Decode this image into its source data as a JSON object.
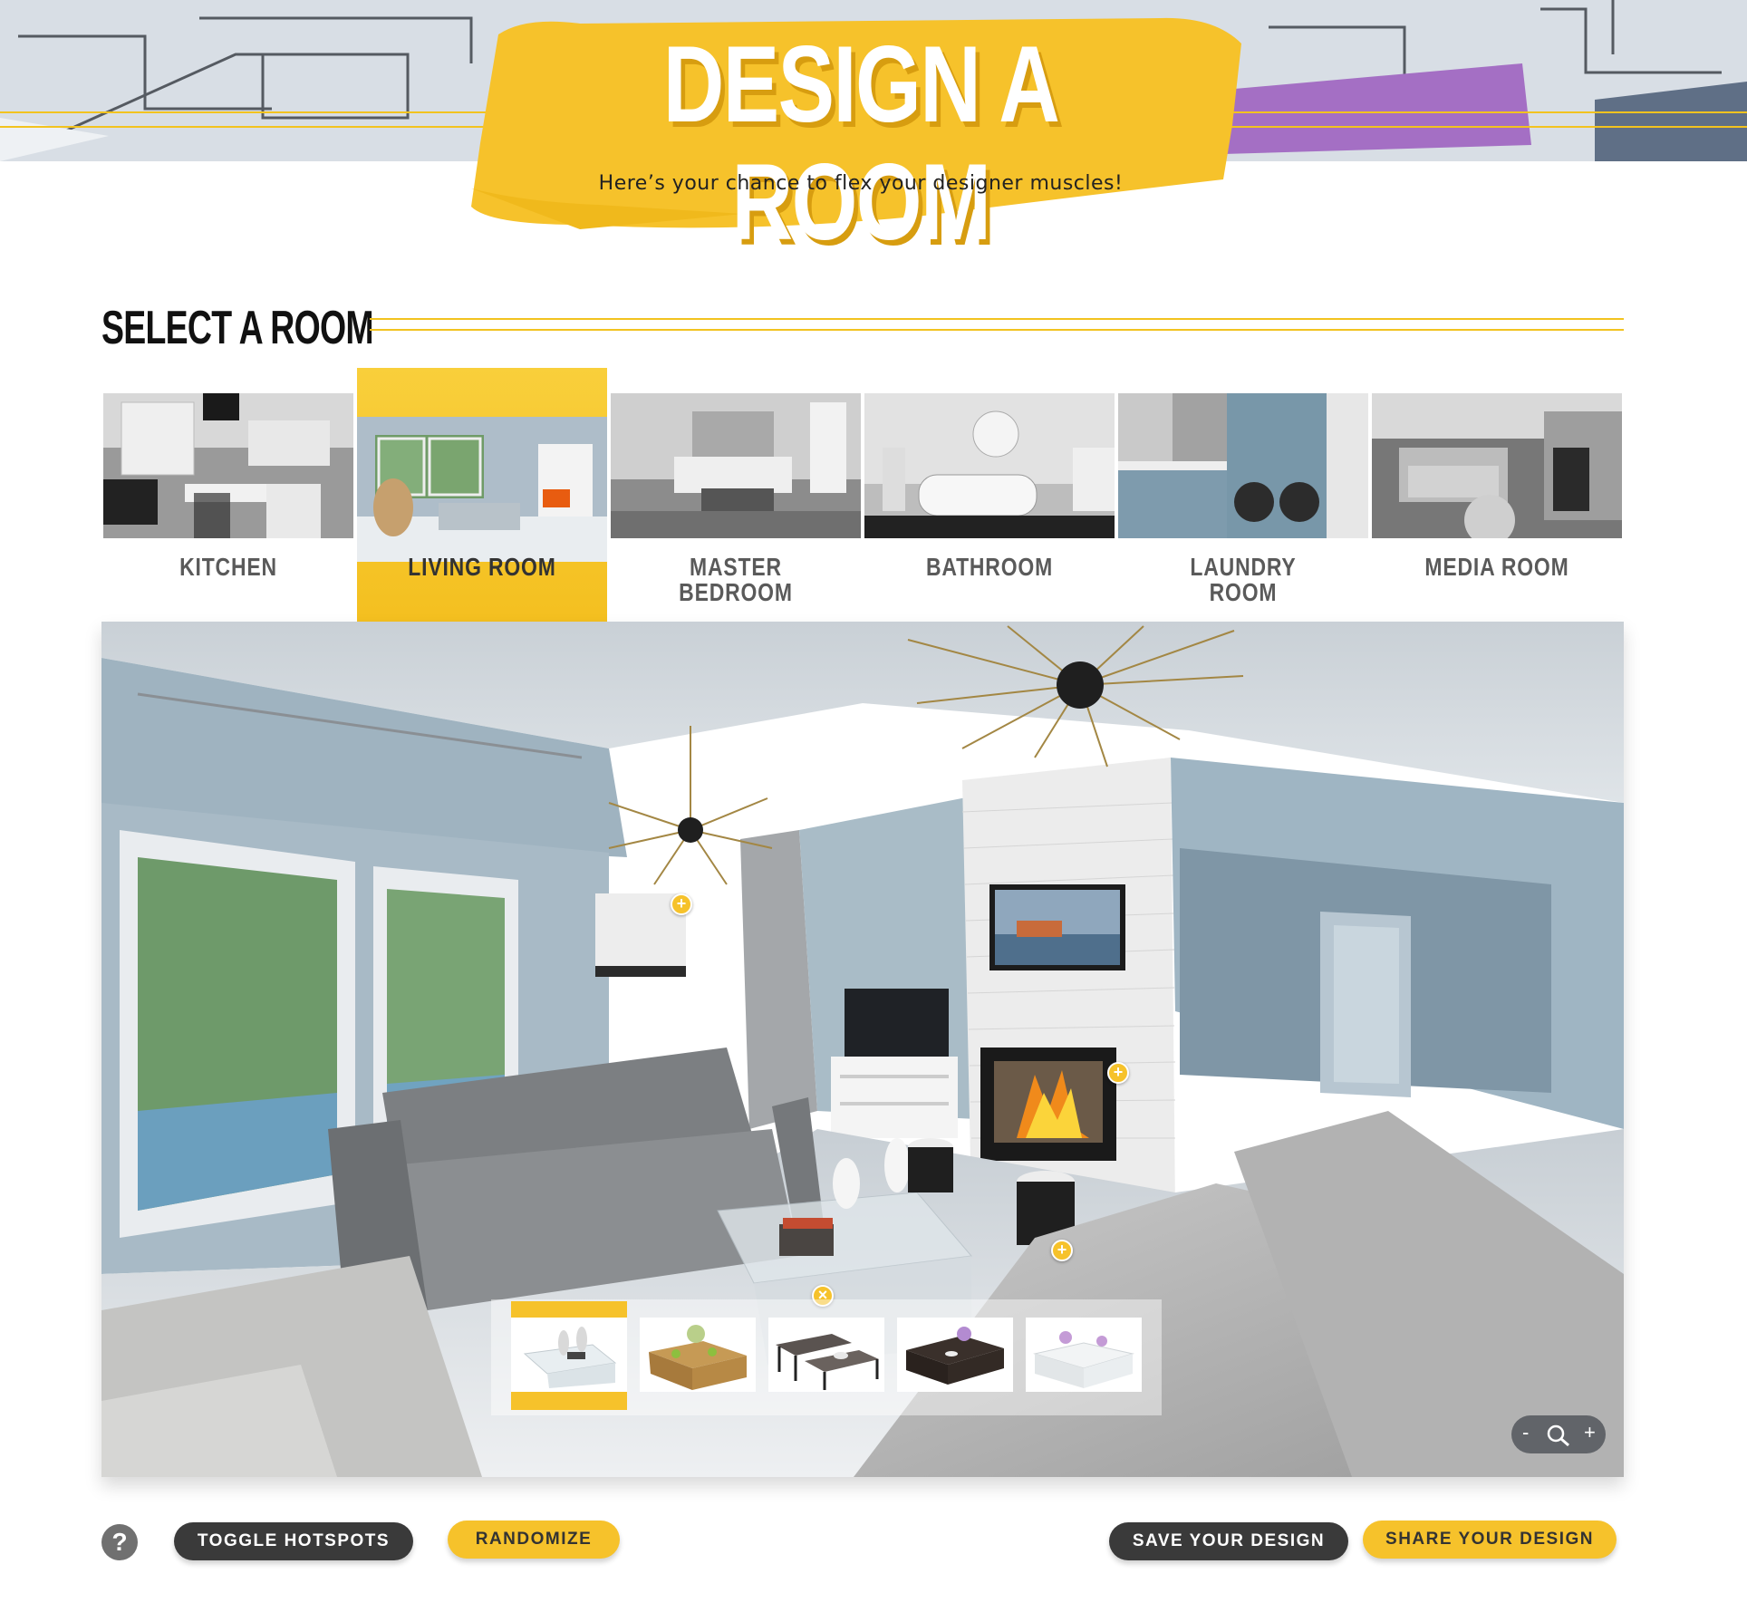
{
  "header": {
    "title": "DESIGN A ROOM",
    "subtitle": "Here’s your chance to flex your designer muscles!"
  },
  "section": {
    "title": "SELECT A ROOM"
  },
  "rooms": [
    {
      "label": "KITCHEN",
      "active": false
    },
    {
      "label": "LIVING ROOM",
      "active": true
    },
    {
      "label": "MASTER\nBEDROOM",
      "active": false
    },
    {
      "label": "BATHROOM",
      "active": false
    },
    {
      "label": "LAUNDRY\nROOM",
      "active": false
    },
    {
      "label": "MEDIA ROOM",
      "active": false
    }
  ],
  "viewer": {
    "hotspot_symbol": "+",
    "close_symbol": "×",
    "item_options": [
      {
        "name": "glass-waterfall-table",
        "selected": true
      },
      {
        "name": "rustic-trunk-table",
        "selected": false
      },
      {
        "name": "industrial-nesting-tables",
        "selected": false
      },
      {
        "name": "dark-wood-table",
        "selected": false
      },
      {
        "name": "white-lacquer-table",
        "selected": false
      }
    ],
    "zoom": {
      "minus": "-",
      "plus": "+"
    }
  },
  "controls": {
    "help": "?",
    "toggle_hotspots": "TOGGLE HOTSPOTS",
    "randomize": "RANDOMIZE",
    "save": "SAVE YOUR DESIGN",
    "share": "SHARE YOUR DESIGN"
  },
  "colors": {
    "accent": "#f6c22b",
    "dark_button": "#3a3a3a",
    "heading": "#111111"
  }
}
